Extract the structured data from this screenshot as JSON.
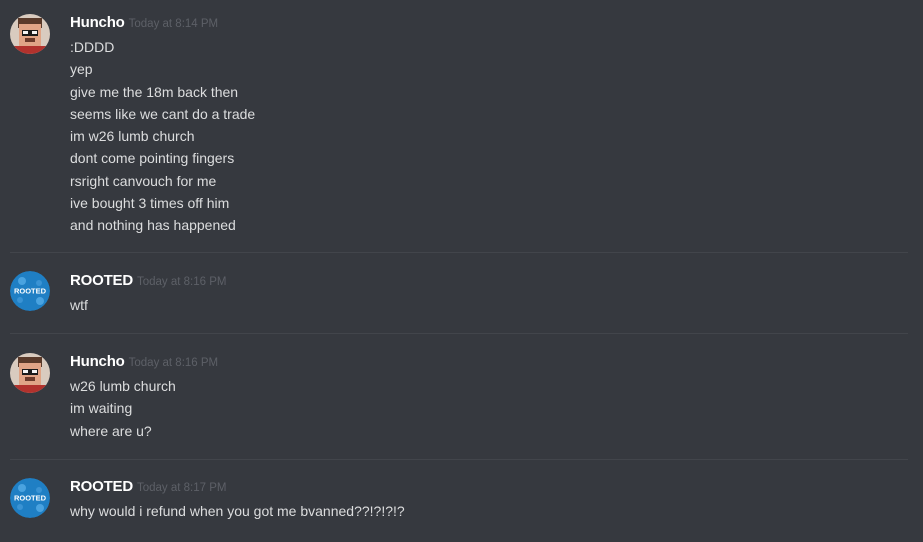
{
  "groups": [
    {
      "author": "Huncho",
      "timestamp": "Today at 8:14 PM",
      "avatar": "pixel-face-avatar",
      "messages": [
        ":DDDD",
        "yep",
        "give me the 18m back then",
        "seems like we cant do a trade",
        "im w26 lumb church",
        "dont come pointing fingers",
        "rsright canvouch for me",
        "ive bought 3 times off him",
        "and nothing has happened"
      ]
    },
    {
      "author": "ROOTED",
      "timestamp": "Today at 8:16 PM",
      "avatar": "rooted-logo-avatar",
      "avatar_text": "ROOTED",
      "messages": [
        "wtf"
      ]
    },
    {
      "author": "Huncho",
      "timestamp": "Today at 8:16 PM",
      "avatar": "pixel-face-avatar",
      "messages": [
        "w26 lumb church",
        "im waiting",
        "where are u?"
      ]
    },
    {
      "author": "ROOTED",
      "timestamp": "Today at 8:17 PM",
      "avatar": "rooted-logo-avatar",
      "avatar_text": "ROOTED",
      "messages": [
        "why would i refund when you got me bvanned??!?!?!?"
      ]
    }
  ],
  "colors": {
    "background": "#36393f",
    "username": "#ffffff",
    "message_text": "#dcddde",
    "timestamp": "#5d6067",
    "divider": "#42454b",
    "rooted_avatar": "#1f7fc4"
  }
}
